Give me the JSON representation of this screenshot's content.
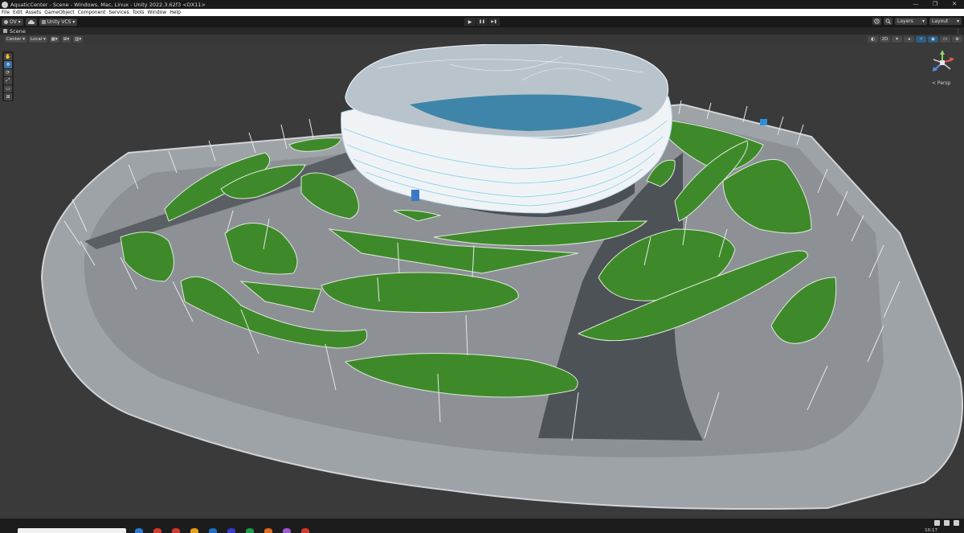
{
  "window": {
    "title": "AquaticCenter - Scene - Windows, Mac, Linux - Unity 2022.3.62f3 <DX11>",
    "controls": [
      "—",
      "❐",
      "✕"
    ]
  },
  "menubar": {
    "items": [
      "File",
      "Edit",
      "Assets",
      "GameObject",
      "Component",
      "Services",
      "Tools",
      "Window",
      "Help"
    ]
  },
  "toolbar": {
    "account_label": "OV ▾",
    "cloud_icon": "cloud-icon",
    "vcs_label": "Unity VCS ▾",
    "play_icon": "▶",
    "pause_icon": "❚❚",
    "step_icon": "▶❚",
    "history_icon": "history-icon",
    "search_icon": "search-icon",
    "layers_label": "Layers",
    "layout_label": "Layout"
  },
  "scene_tab": {
    "label": "Scene",
    "menu": "⋮"
  },
  "scene_toolbar": {
    "pivot_label": "Center ▾",
    "space_label": "Local ▾",
    "mode_2d": "2D"
  },
  "tools": [
    "✋",
    "✥",
    "⟳",
    "⤢",
    "▭",
    "⊞"
  ],
  "gizmo": {
    "projection_label": "< Persp"
  },
  "taskbar": {
    "clock": "10:17",
    "app_colors": [
      "#2e7bd6",
      "#d23a2f",
      "#d23a2f",
      "#e8a01a",
      "#1f6fc7",
      "#3b3bd0",
      "#1b9e4b",
      "#e06b1f",
      "#9b59d0",
      "#d23a2f"
    ]
  }
}
